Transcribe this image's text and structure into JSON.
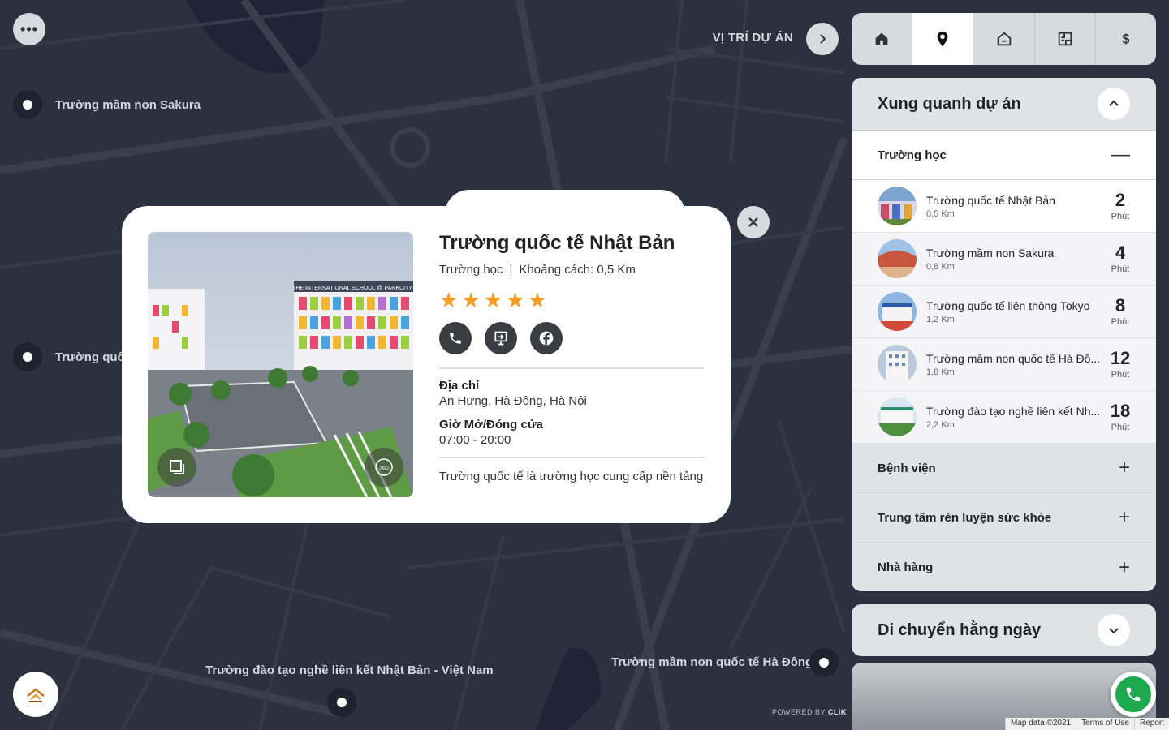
{
  "map": {
    "pins": [
      {
        "label": "Trường mầm non Sakura"
      },
      {
        "label": "Trường quốc"
      },
      {
        "label": "Trường đào tạo nghề liên kết Nhật Bản - Việt Nam"
      },
      {
        "label": "Trường mầm non quốc tế Hà Đông"
      }
    ],
    "location_title": "VỊ TRÍ DỰ ÁN",
    "powered_prefix": "POWERED BY",
    "powered_brand": "CLIK",
    "attribution": [
      "Map data ©2021",
      "Terms of Use",
      "Report"
    ]
  },
  "top_tabs": [
    {
      "icon": "home-icon",
      "active": false
    },
    {
      "icon": "location-pin-icon",
      "active": true
    },
    {
      "icon": "house-icon",
      "active": false
    },
    {
      "icon": "floorplan-icon",
      "active": false
    },
    {
      "icon": "dollar-icon",
      "active": false
    }
  ],
  "panel": {
    "title": "Xung quanh dự án",
    "open_section": "Trường học",
    "places": [
      {
        "name": "Trường quốc tế Nhật Bản",
        "distance": "0,5 Km",
        "minutes": "2",
        "unit": "Phút"
      },
      {
        "name": "Trường mầm non Sakura",
        "distance": "0,8 Km",
        "minutes": "4",
        "unit": "Phút"
      },
      {
        "name": "Trường quốc tế liên thông Tokyo",
        "distance": "1,2 Km",
        "minutes": "8",
        "unit": "Phút"
      },
      {
        "name": "Trường mầm non quốc tế Hà Đô...",
        "distance": "1,8 Km",
        "minutes": "12",
        "unit": "Phút"
      },
      {
        "name": "Trường đào tạo nghề liên kết Nh...",
        "distance": "2,2 Km",
        "minutes": "18",
        "unit": "Phút"
      }
    ],
    "collapsed_sections": [
      "Bệnh viện",
      "Trung tâm rèn luyện sức khỏe",
      "Nhà hàng"
    ]
  },
  "panel2": {
    "title": "Di chuyển hằng ngày"
  },
  "popup": {
    "title": "Trường quốc tế Nhật Bản",
    "category": "Trường học",
    "separator": "|",
    "distance": "Khoảng cách: 0,5 Km",
    "rating": 5,
    "address_label": "Địa chỉ",
    "address": "An Hưng, Hà Đông, Hà Nội",
    "hours_label": "Giờ Mở/Đóng cửa",
    "hours": "07:00 - 20:00",
    "description": "Trường quốc tế là trường học cung cấp nền tảng",
    "image_sign": "THE INTERNATIONAL SCHOOL @ PARKCITY"
  },
  "colors": {
    "accent_star": "#f59a23",
    "call_green": "#1ea94f",
    "map_bg": "#2c3140"
  }
}
